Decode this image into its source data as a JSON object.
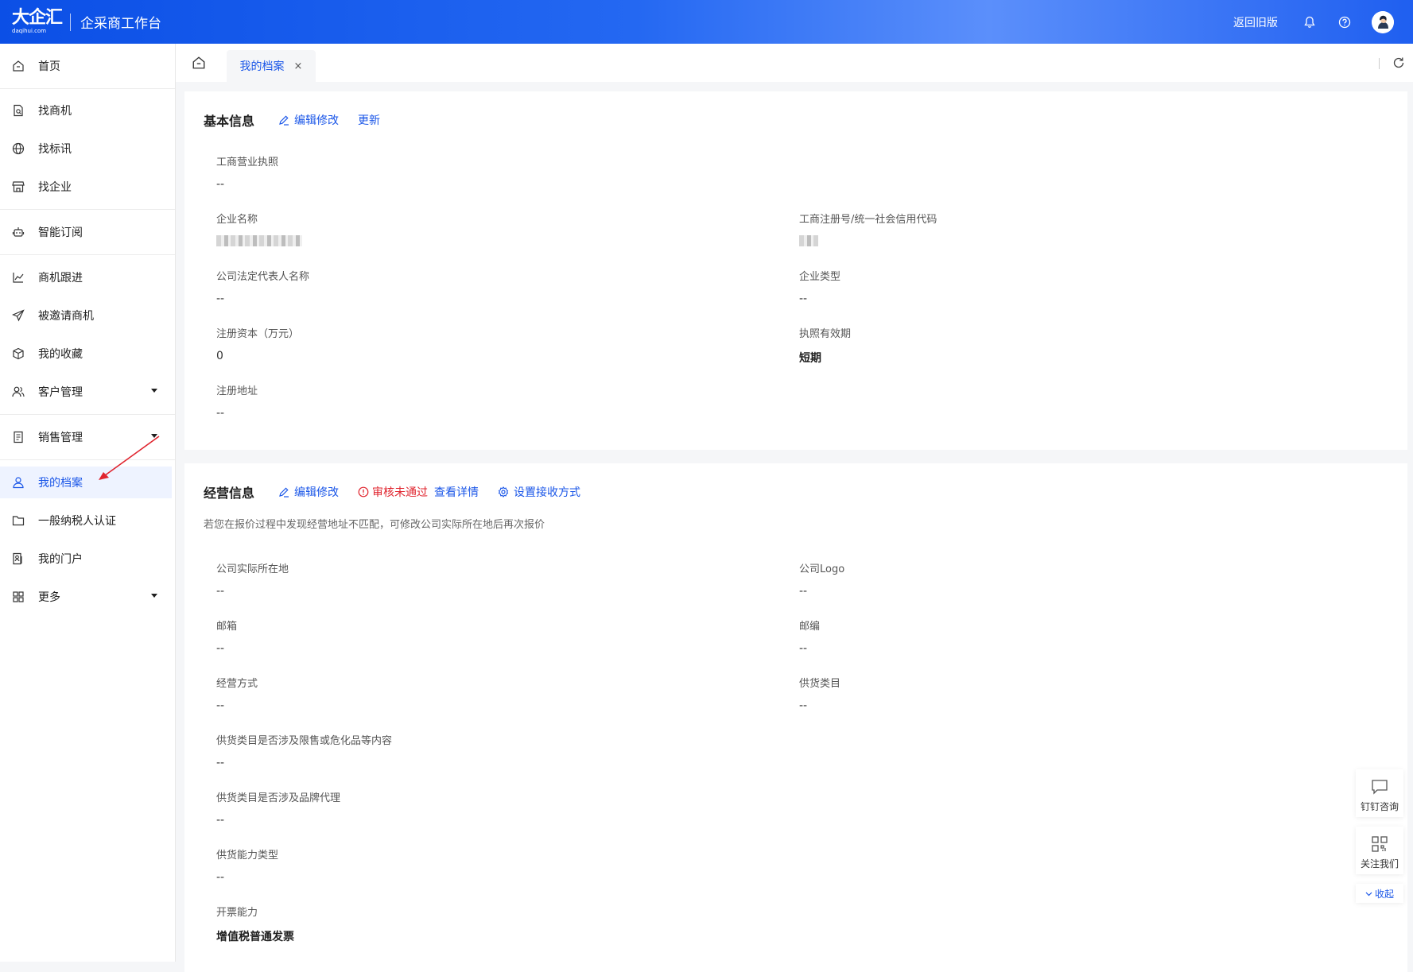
{
  "header": {
    "logo_text": "大企汇",
    "logo_sub": "daqihui.com",
    "app_title": "企采商工作台",
    "back_old": "返回旧版"
  },
  "sidebar": {
    "items": [
      {
        "label": "首页",
        "icon": "home-icon"
      },
      {
        "label": "找商机",
        "icon": "doc-search-icon"
      },
      {
        "label": "找标讯",
        "icon": "globe-icon"
      },
      {
        "label": "找企业",
        "icon": "store-icon"
      },
      {
        "label": "智能订阅",
        "icon": "robot-icon"
      },
      {
        "label": "商机跟进",
        "icon": "chart-icon"
      },
      {
        "label": "被邀请商机",
        "icon": "send-icon"
      },
      {
        "label": "我的收藏",
        "icon": "box-icon"
      },
      {
        "label": "客户管理",
        "icon": "users-icon"
      },
      {
        "label": "销售管理",
        "icon": "report-icon"
      },
      {
        "label": "我的档案",
        "icon": "user-icon"
      },
      {
        "label": "一般纳税人认证",
        "icon": "folder-icon"
      },
      {
        "label": "我的门户",
        "icon": "portal-icon"
      },
      {
        "label": "更多",
        "icon": "grid-icon"
      }
    ]
  },
  "tabs": {
    "active_label": "我的档案",
    "close": "×"
  },
  "basic": {
    "title": "基本信息",
    "edit": "编辑修改",
    "update": "更新",
    "fields": {
      "license": {
        "label": "工商营业执照",
        "value": "--"
      },
      "company_name": {
        "label": "企业名称"
      },
      "reg_code": {
        "label": "工商注册号/统一社会信用代码"
      },
      "legal_rep": {
        "label": "公司法定代表人名称",
        "value": "--"
      },
      "company_type": {
        "label": "企业类型",
        "value": "--"
      },
      "capital": {
        "label": "注册资本（万元）",
        "value": "0"
      },
      "validity": {
        "label": "执照有效期",
        "value": "短期"
      },
      "address": {
        "label": "注册地址",
        "value": "--"
      }
    }
  },
  "business": {
    "title": "经营信息",
    "edit": "编辑修改",
    "status": "审核未通过",
    "detail": "查看详情",
    "receive": "设置接收方式",
    "tip": "若您在报价过程中发现经营地址不匹配，可修改公司实际所在地后再次报价",
    "fields": {
      "location": {
        "label": "公司实际所在地",
        "value": "--"
      },
      "logo": {
        "label": "公司Logo",
        "value": "--"
      },
      "email": {
        "label": "邮箱",
        "value": "--"
      },
      "zip": {
        "label": "邮编",
        "value": "--"
      },
      "mode": {
        "label": "经营方式",
        "value": "--"
      },
      "category": {
        "label": "供货类目",
        "value": "--"
      },
      "restricted": {
        "label": "供货类目是否涉及限售或危化品等内容",
        "value": "--"
      },
      "brand": {
        "label": "供货类目是否涉及品牌代理",
        "value": "--"
      },
      "capacity": {
        "label": "供货能力类型",
        "value": "--"
      },
      "invoice": {
        "label": "开票能力",
        "value": "增值税普通发票"
      }
    }
  },
  "float": {
    "dingtalk": "钉钉咨询",
    "follow": "关注我们",
    "collapse": "收起"
  },
  "colors": {
    "primary": "#1a56e8",
    "error": "#e0242e",
    "header_start": "#0b4fe6"
  }
}
